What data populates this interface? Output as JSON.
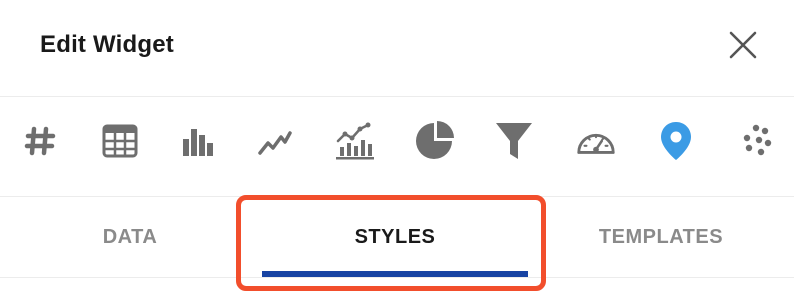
{
  "dialog": {
    "title": "Edit Widget"
  },
  "widget_types": [
    {
      "icon": "hash-icon"
    },
    {
      "icon": "table-icon"
    },
    {
      "icon": "bar-chart-icon"
    },
    {
      "icon": "line-chart-icon"
    },
    {
      "icon": "combo-chart-icon"
    },
    {
      "icon": "pie-chart-icon"
    },
    {
      "icon": "funnel-icon"
    },
    {
      "icon": "gauge-icon"
    },
    {
      "icon": "map-pin-icon",
      "selected": true
    },
    {
      "icon": "scatter-icon"
    }
  ],
  "tabs": [
    {
      "label": "DATA",
      "active": false
    },
    {
      "label": "STYLES",
      "active": true
    },
    {
      "label": "TEMPLATES",
      "active": false
    }
  ],
  "colors": {
    "icon_gray": "#6e6e6e",
    "icon_selected": "#3b9be5",
    "tab_active_underline": "#1743a3",
    "highlight_border": "#f24e2c"
  }
}
